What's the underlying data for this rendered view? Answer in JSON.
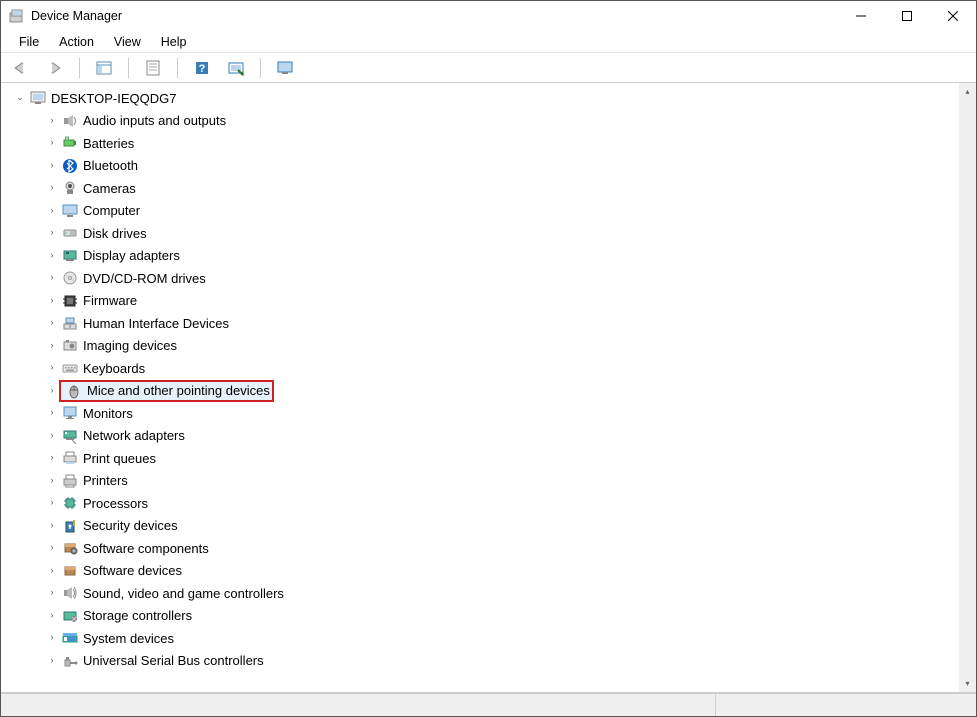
{
  "window": {
    "title": "Device Manager"
  },
  "menu": {
    "file": "File",
    "action": "Action",
    "view": "View",
    "help": "Help"
  },
  "root": {
    "label": "DESKTOP-IEQQDG7"
  },
  "highlight_index": 12,
  "categories": [
    {
      "label": "Audio inputs and outputs",
      "icon": "speaker-icon"
    },
    {
      "label": "Batteries",
      "icon": "battery-icon"
    },
    {
      "label": "Bluetooth",
      "icon": "bluetooth-icon"
    },
    {
      "label": "Cameras",
      "icon": "camera-icon"
    },
    {
      "label": "Computer",
      "icon": "computer-icon"
    },
    {
      "label": "Disk drives",
      "icon": "disk-icon"
    },
    {
      "label": "Display adapters",
      "icon": "display-adapter-icon"
    },
    {
      "label": "DVD/CD-ROM drives",
      "icon": "dvd-icon"
    },
    {
      "label": "Firmware",
      "icon": "firmware-icon"
    },
    {
      "label": "Human Interface Devices",
      "icon": "hid-icon"
    },
    {
      "label": "Imaging devices",
      "icon": "imaging-icon"
    },
    {
      "label": "Keyboards",
      "icon": "keyboard-icon"
    },
    {
      "label": "Mice and other pointing devices",
      "icon": "mouse-icon"
    },
    {
      "label": "Monitors",
      "icon": "monitor-icon"
    },
    {
      "label": "Network adapters",
      "icon": "network-icon"
    },
    {
      "label": "Print queues",
      "icon": "print-queue-icon"
    },
    {
      "label": "Printers",
      "icon": "printer-icon"
    },
    {
      "label": "Processors",
      "icon": "processor-icon"
    },
    {
      "label": "Security devices",
      "icon": "security-icon"
    },
    {
      "label": "Software components",
      "icon": "software-comp-icon"
    },
    {
      "label": "Software devices",
      "icon": "software-dev-icon"
    },
    {
      "label": "Sound, video and game controllers",
      "icon": "sound-icon"
    },
    {
      "label": "Storage controllers",
      "icon": "storage-icon"
    },
    {
      "label": "System devices",
      "icon": "system-icon"
    },
    {
      "label": "Universal Serial Bus controllers",
      "icon": "usb-icon"
    }
  ]
}
